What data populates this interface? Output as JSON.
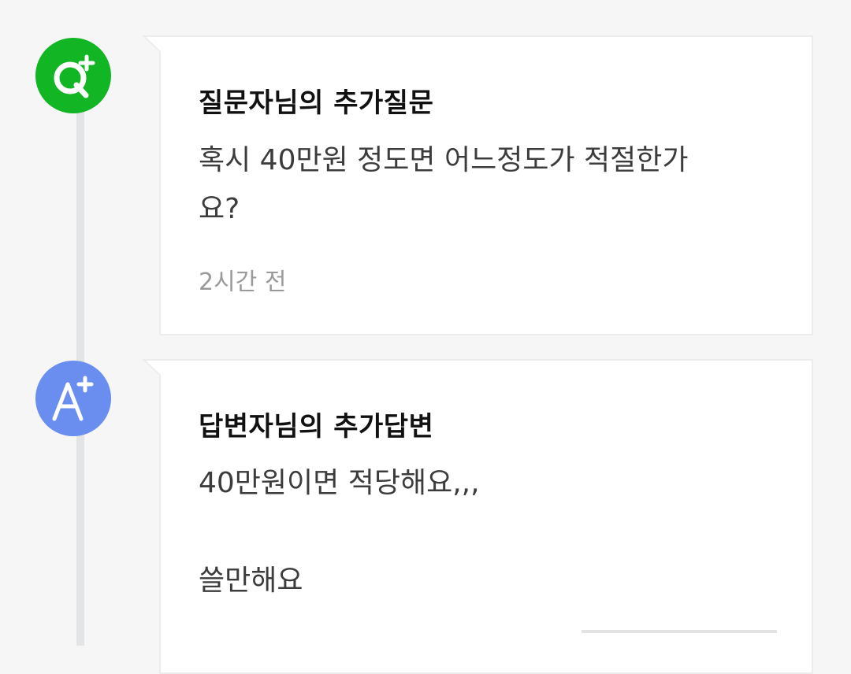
{
  "timeline": {
    "question_entry": {
      "icon": "q-plus-icon",
      "accent": "#12b523",
      "title": "질문자님의 추가질문",
      "body_lines": [
        "혹시 40만원 정도면 어느정도가 적절한가",
        "요?"
      ],
      "time": "2시간 전"
    },
    "answer_entry": {
      "icon": "a-plus-icon",
      "accent": "#6a8df0",
      "title": "답변자님의 추가답변",
      "body_lines": [
        "40만원이면 적당해요,,,",
        "쓸만해요"
      ]
    }
  }
}
